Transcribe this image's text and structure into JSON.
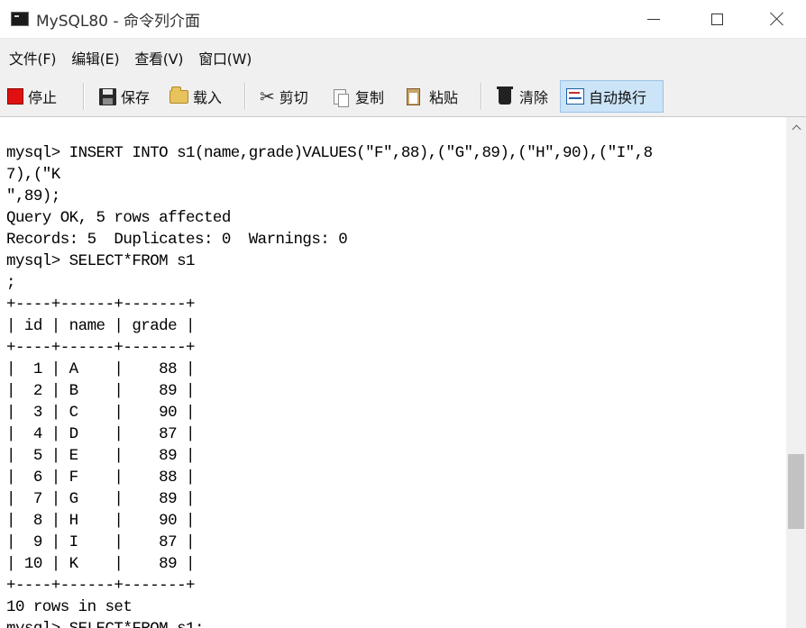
{
  "window": {
    "title": "MySQL80 - 命令列介面",
    "minimize": "minimize",
    "maximize": "maximize",
    "close": "close"
  },
  "menu": [
    "文件(F)",
    "编辑(E)",
    "查看(V)",
    "窗口(W)"
  ],
  "toolbar": {
    "stop": "停止",
    "save": "保存",
    "load": "载入",
    "cut": "剪切",
    "copy": "复制",
    "paste": "粘贴",
    "clear": "清除",
    "wrap": "自动换行",
    "wrap_active": true
  },
  "console": {
    "lines": [
      "mysql> INSERT INTO s1(name,grade)VALUES(\"F\",88),(\"G\",89),(\"H\",90),(\"I\",8",
      "7),(\"K",
      "\",89);",
      "Query OK, 5 rows affected",
      "Records: 5  Duplicates: 0  Warnings: 0",
      "mysql> SELECT*FROM s1",
      ";",
      "+----+------+-------+",
      "| id | name | grade |",
      "+----+------+-------+",
      "|  1 | A    |    88 |",
      "|  2 | B    |    89 |",
      "|  3 | C    |    90 |",
      "|  4 | D    |    87 |",
      "|  5 | E    |    89 |",
      "|  6 | F    |    88 |",
      "|  7 | G    |    89 |",
      "|  8 | H    |    90 |",
      "|  9 | I    |    87 |",
      "| 10 | K    |    89 |",
      "+----+------+-------+",
      "10 rows in set",
      "mysql> SELECT*FROM s1;"
    ]
  },
  "colors": {
    "titlebar": "#ffffff",
    "chrome": "#f0f0f0",
    "console_bg": "#ffffff",
    "console_text": "#000000",
    "active_button": "#cce4f7",
    "stop_red": "#e01010"
  },
  "icons": {
    "app": "terminal-icon",
    "stop": "stop-icon",
    "save": "floppy-icon",
    "load": "folder-icon",
    "cut": "scissors-icon",
    "copy": "copy-icon",
    "paste": "clipboard-icon",
    "clear": "trash-icon",
    "wrap": "wrap-text-icon"
  }
}
